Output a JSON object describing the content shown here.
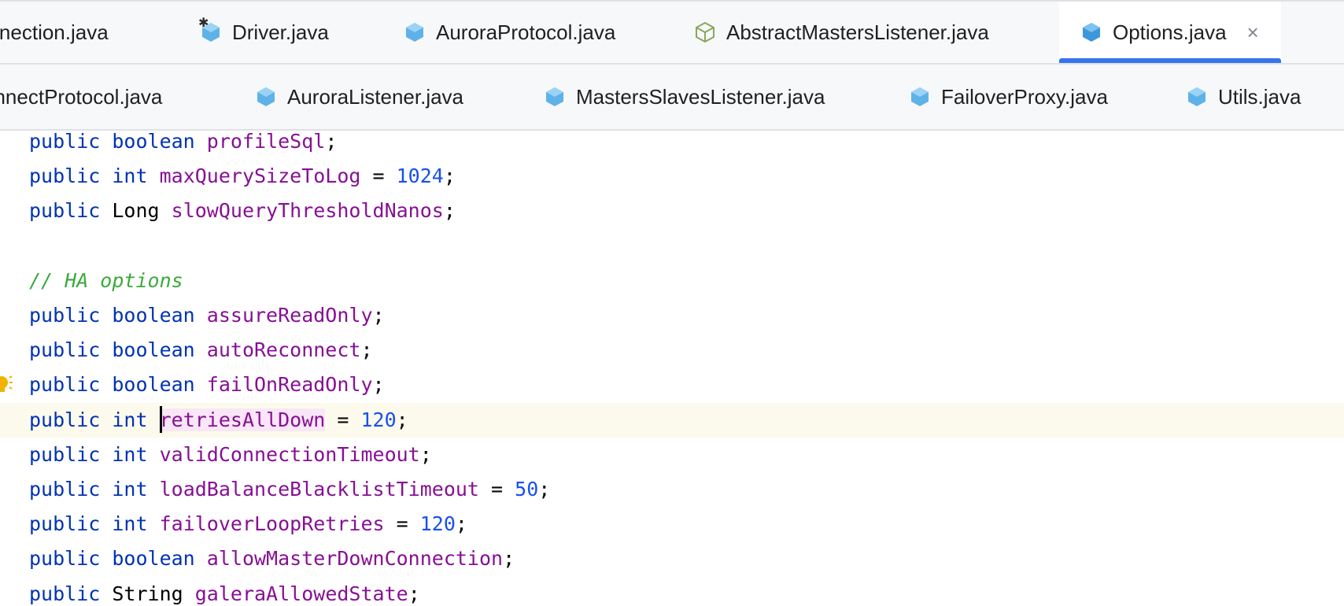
{
  "tabs_row1": [
    {
      "label": "onnection.java",
      "icon": "class-icon",
      "active": false
    },
    {
      "label": "Driver.java",
      "icon": "class-snowflake-icon",
      "active": false
    },
    {
      "label": "AuroraProtocol.java",
      "icon": "class-icon",
      "active": false
    },
    {
      "label": "AbstractMastersListener.java",
      "icon": "abstract-class-icon",
      "active": false
    },
    {
      "label": "Options.java",
      "icon": "class-icon",
      "active": true,
      "close": "×"
    }
  ],
  "tabs_row2": [
    {
      "label": "onnectProtocol.java",
      "icon": "class-icon"
    },
    {
      "label": "AuroraListener.java",
      "icon": "class-icon"
    },
    {
      "label": "MastersSlavesListener.java",
      "icon": "class-icon"
    },
    {
      "label": "FailoverProxy.java",
      "icon": "class-icon"
    },
    {
      "label": "Utils.java",
      "icon": "class-icon"
    }
  ],
  "editor": {
    "lines": [
      {
        "tokens": [
          [
            "kw",
            "public"
          ],
          [
            "pn",
            " "
          ],
          [
            "kw",
            "boolean"
          ],
          [
            "pn",
            " "
          ],
          [
            "fd",
            "profileSql"
          ],
          [
            "pn",
            ";"
          ]
        ]
      },
      {
        "tokens": [
          [
            "kw",
            "public"
          ],
          [
            "pn",
            " "
          ],
          [
            "kw",
            "int"
          ],
          [
            "pn",
            " "
          ],
          [
            "fd",
            "maxQuerySizeToLog"
          ],
          [
            "pn",
            " = "
          ],
          [
            "nm",
            "1024"
          ],
          [
            "pn",
            ";"
          ]
        ]
      },
      {
        "tokens": [
          [
            "kw",
            "public"
          ],
          [
            "pn",
            " "
          ],
          [
            "ty",
            "Long"
          ],
          [
            "pn",
            " "
          ],
          [
            "fd",
            "slowQueryThresholdNanos"
          ],
          [
            "pn",
            ";"
          ]
        ]
      },
      {
        "tokens": []
      },
      {
        "tokens": [
          [
            "cm",
            "// HA options"
          ]
        ]
      },
      {
        "tokens": [
          [
            "kw",
            "public"
          ],
          [
            "pn",
            " "
          ],
          [
            "kw",
            "boolean"
          ],
          [
            "pn",
            " "
          ],
          [
            "fd",
            "assureReadOnly"
          ],
          [
            "pn",
            ";"
          ]
        ]
      },
      {
        "tokens": [
          [
            "kw",
            "public"
          ],
          [
            "pn",
            " "
          ],
          [
            "kw",
            "boolean"
          ],
          [
            "pn",
            " "
          ],
          [
            "fd",
            "autoReconnect"
          ],
          [
            "pn",
            ";"
          ]
        ]
      },
      {
        "tokens": [
          [
            "kw",
            "public"
          ],
          [
            "pn",
            " "
          ],
          [
            "kw",
            "boolean"
          ],
          [
            "pn",
            " "
          ],
          [
            "fd",
            "failOnReadOnly"
          ],
          [
            "pn",
            ";"
          ]
        ],
        "bulb": true
      },
      {
        "tokens": [
          [
            "kw",
            "public"
          ],
          [
            "pn",
            " "
          ],
          [
            "kw",
            "int"
          ],
          [
            "pn",
            " "
          ],
          [
            "caret",
            ""
          ],
          [
            "fdhl",
            "retriesAllDown"
          ],
          [
            "pn",
            " = "
          ],
          [
            "nm",
            "120"
          ],
          [
            "pn",
            ";"
          ]
        ],
        "current": true
      },
      {
        "tokens": [
          [
            "kw",
            "public"
          ],
          [
            "pn",
            " "
          ],
          [
            "kw",
            "int"
          ],
          [
            "pn",
            " "
          ],
          [
            "fd",
            "validConnectionTimeout"
          ],
          [
            "pn",
            ";"
          ]
        ]
      },
      {
        "tokens": [
          [
            "kw",
            "public"
          ],
          [
            "pn",
            " "
          ],
          [
            "kw",
            "int"
          ],
          [
            "pn",
            " "
          ],
          [
            "fd",
            "loadBalanceBlacklistTimeout"
          ],
          [
            "pn",
            " = "
          ],
          [
            "nm",
            "50"
          ],
          [
            "pn",
            ";"
          ]
        ]
      },
      {
        "tokens": [
          [
            "kw",
            "public"
          ],
          [
            "pn",
            " "
          ],
          [
            "kw",
            "int"
          ],
          [
            "pn",
            " "
          ],
          [
            "fd",
            "failoverLoopRetries"
          ],
          [
            "pn",
            " = "
          ],
          [
            "nm",
            "120"
          ],
          [
            "pn",
            ";"
          ]
        ]
      },
      {
        "tokens": [
          [
            "kw",
            "public"
          ],
          [
            "pn",
            " "
          ],
          [
            "kw",
            "boolean"
          ],
          [
            "pn",
            " "
          ],
          [
            "fd",
            "allowMasterDownConnection"
          ],
          [
            "pn",
            ";"
          ]
        ]
      },
      {
        "tokens": [
          [
            "kw",
            "public"
          ],
          [
            "pn",
            " "
          ],
          [
            "ty",
            "String"
          ],
          [
            "pn",
            " "
          ],
          [
            "fd",
            "galeraAllowedState"
          ],
          [
            "pn",
            ";"
          ]
        ]
      }
    ]
  },
  "colors": {
    "keyword": "#0033b3",
    "field": "#871094",
    "number": "#1750eb",
    "comment": "#3aaa3a",
    "accent": "#3574f0"
  }
}
